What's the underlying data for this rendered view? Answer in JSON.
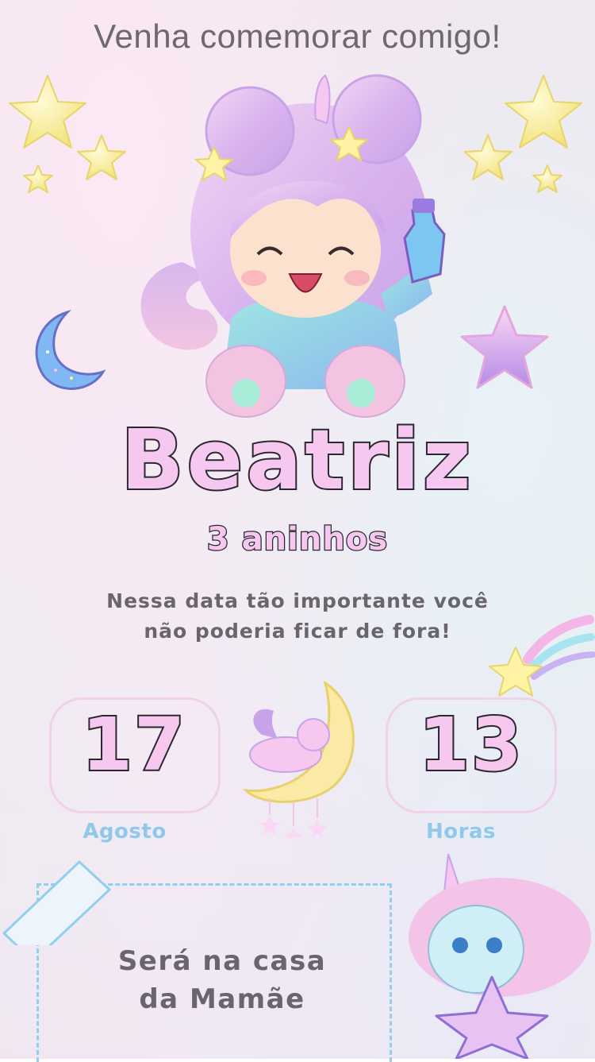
{
  "header": {
    "title": "Venha comemorar comigo!"
  },
  "celebrant": {
    "name": "Beatriz",
    "age": "3 aninhos"
  },
  "message": {
    "line1": "Nessa data tão importante você",
    "line2": "não poderia ficar de fora!"
  },
  "date": {
    "day": "17",
    "month": "Agosto"
  },
  "time": {
    "hour": "13",
    "label": "Horas"
  },
  "location": {
    "line1": "Será na casa",
    "line2": "da Mamãe"
  },
  "icons": [
    "star-icon",
    "moon-icon",
    "shooting-star-icon",
    "unicorn-on-moon-icon",
    "unicorn-with-star-icon",
    "girl-character-illustration"
  ],
  "colors": {
    "accent_pink": "#f6c8f0",
    "outline": "#2a2730",
    "label_blue": "#8fc9ea",
    "text_gray": "#6a646c"
  }
}
